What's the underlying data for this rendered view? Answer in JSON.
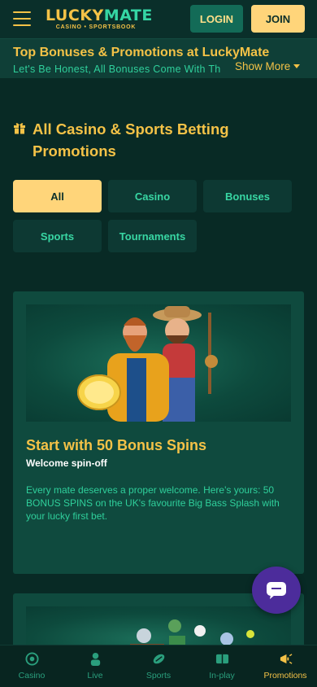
{
  "header": {
    "logo_lucky": "LUCKY",
    "logo_mate": "MATE",
    "logo_sub": "CASINO • SPORTSBOOK",
    "login_label": "LOGIN",
    "join_label": "JOIN"
  },
  "banner": {
    "title": "Top Bonuses & Promotions at LuckyMate",
    "subtitle": "Let's Be Honest, All Bonuses Come With Th",
    "show_more": "Show More"
  },
  "section": {
    "title": "All Casino & Sports Betting Promotions",
    "icon": "gift-icon"
  },
  "filters": [
    {
      "label": "All",
      "active": true
    },
    {
      "label": "Casino",
      "active": false
    },
    {
      "label": "Bonuses",
      "active": false
    },
    {
      "label": "Sports",
      "active": false
    },
    {
      "label": "Tournaments",
      "active": false
    }
  ],
  "cards": [
    {
      "title": "Start with 50 Bonus Spins",
      "subtitle": "Welcome spin-off",
      "description": "Every mate deserves a proper welcome. Here's yours: 50 BONUS SPINS on the UK's favourite Big Bass Splash with your lucky first bet."
    }
  ],
  "bottom_nav": [
    {
      "label": "Casino",
      "icon": "casino-chip-icon",
      "active": false
    },
    {
      "label": "Live",
      "icon": "live-dealer-icon",
      "active": false
    },
    {
      "label": "Sports",
      "icon": "sports-ball-icon",
      "active": false
    },
    {
      "label": "In-play",
      "icon": "scoreboard-icon",
      "active": false
    },
    {
      "label": "Promotions",
      "icon": "megaphone-icon",
      "active": true
    }
  ],
  "colors": {
    "background": "#082a25",
    "accent_gold": "#f4c247",
    "accent_green": "#2fcf9b",
    "card": "#0f4a3e",
    "chat": "#4c2c9b"
  }
}
